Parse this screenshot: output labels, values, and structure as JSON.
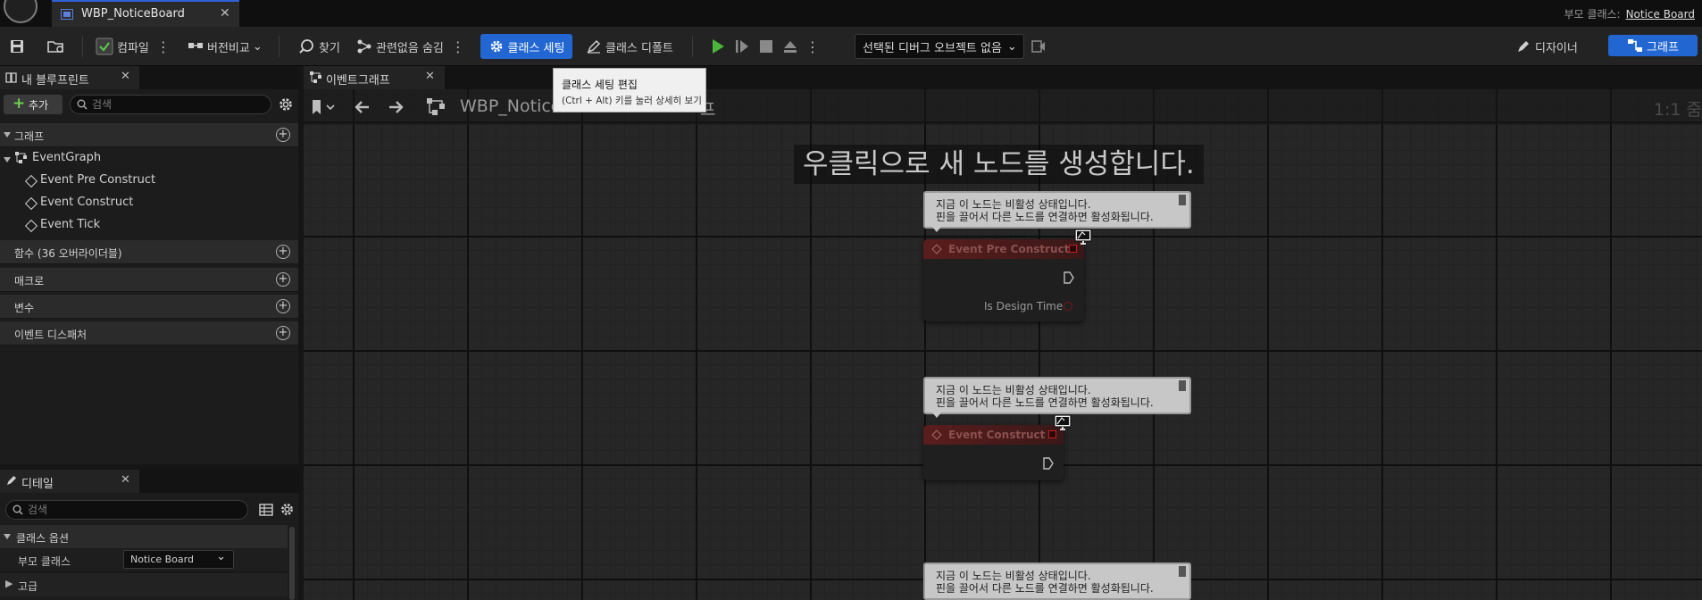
{
  "title_bar": {
    "doc_tab": "WBP_NoticeBoard",
    "parent_class_label": "부모 클래스:",
    "parent_class_value": "Notice Board"
  },
  "toolbar": {
    "compile": "컴파일",
    "diff": "버전비교",
    "find": "찾기",
    "hide_unrelated": "관련없음 숨김",
    "class_settings": "클래스 세팅",
    "class_defaults": "클래스 디폴트",
    "debug_object": "선택된 디버그 오브젝트 없음",
    "designer": "디자이너",
    "graph": "그래프",
    "accent": "#2166d1"
  },
  "tooltip": {
    "title": "클래스 세팅 편집",
    "hint": "(Ctrl + Alt) 키를 눌러 상세히 보기"
  },
  "my_blueprint": {
    "tab": "내 블루프린트",
    "add": "추가",
    "search_placeholder": "검색",
    "graphs_section": "그래프",
    "event_graph": "EventGraph",
    "events": [
      "Event Pre Construct",
      "Event Construct",
      "Event Tick"
    ],
    "functions_section": "함수 (36 오버라이더블)",
    "macros_section": "매크로",
    "variables_section": "변수",
    "dispatchers_section": "이벤트 디스패처"
  },
  "details": {
    "tab": "디테일",
    "search_placeholder": "검색",
    "class_options": "클래스 옵션",
    "parent_class_label": "부모 클래스",
    "parent_class_value": "Notice Board",
    "advanced": "고급"
  },
  "graph": {
    "tab": "이벤트그래프",
    "breadcrumb": "WBP_Notice",
    "breadcrumb_tail": "프",
    "zoom": "1:1 줌",
    "hint": "우클릭으로 새 노드를 생성합니다.",
    "comment_line1": "지금 이 노드는 비활성 상태입니다.",
    "comment_line2": "핀을 끌어서 다른 노드를 연결하면 활성화됩니다.",
    "node1_title": "Event Pre Construct",
    "node1_pin": "Is Design Time",
    "node2_title": "Event Construct"
  }
}
